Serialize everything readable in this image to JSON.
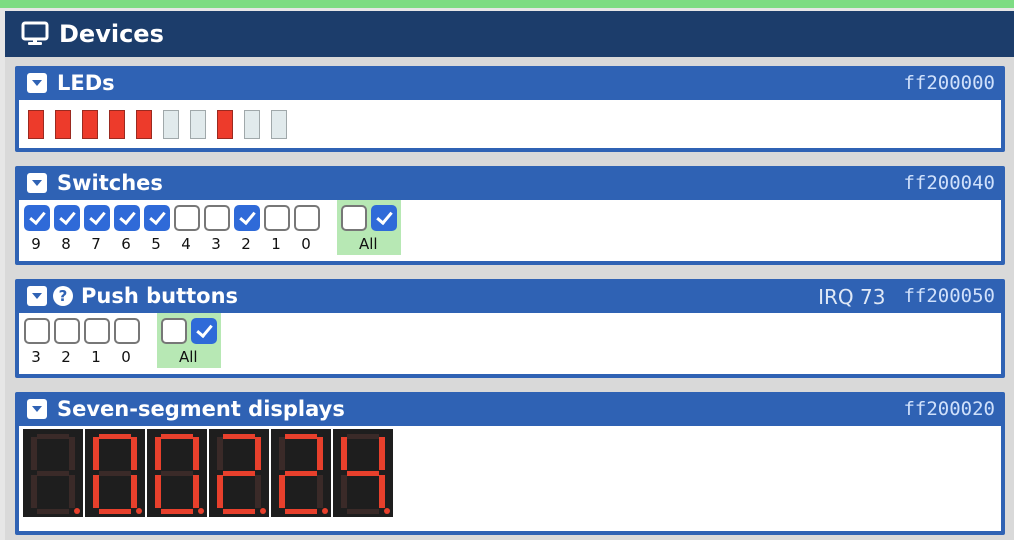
{
  "window": {
    "title": "Devices"
  },
  "leds": {
    "title": "LEDs",
    "address": "ff200000",
    "states": [
      1,
      1,
      1,
      1,
      1,
      0,
      0,
      1,
      0,
      0
    ]
  },
  "switches": {
    "title": "Switches",
    "address": "ff200040",
    "labels": [
      "9",
      "8",
      "7",
      "6",
      "5",
      "4",
      "3",
      "2",
      "1",
      "0"
    ],
    "states": [
      1,
      1,
      1,
      1,
      1,
      0,
      0,
      1,
      0,
      0
    ],
    "all_label": "All",
    "all_states": [
      0,
      1
    ]
  },
  "push_buttons": {
    "title": "Push buttons",
    "irq": "IRQ 73",
    "address": "ff200050",
    "labels": [
      "3",
      "2",
      "1",
      "0"
    ],
    "states": [
      0,
      0,
      0,
      0
    ],
    "all_label": "All",
    "all_states": [
      0,
      1
    ]
  },
  "seven_seg": {
    "title": "Seven-segment displays",
    "address": "ff200020",
    "digits": [
      "",
      "0",
      "0",
      "2",
      "2",
      "4"
    ]
  },
  "colors": {
    "accent": "#2f62b4",
    "header": "#1c3d6b",
    "led_on": "#ed3b2b",
    "seg_on": "#e8402c",
    "seg_off": "#3a2a28"
  }
}
